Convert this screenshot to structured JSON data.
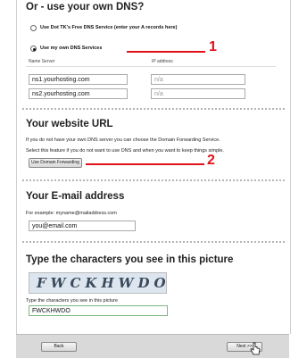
{
  "dns": {
    "title": "Or - use your own DNS?",
    "option_free": "Use Dot TK's Free DNS Service (enter your A records here)",
    "option_own": "Use my own DNS Services",
    "col_name_server": "Name Server",
    "col_ip": "IP address",
    "rows": [
      {
        "server": "ns1.yourhosting.com",
        "ip": "n/a"
      },
      {
        "server": "ns2.yourhosting.com",
        "ip": "n/a"
      }
    ]
  },
  "url": {
    "title": "Your website URL",
    "desc1": "If you do not have your own DNS server you can choose the Domain Forwarding Service.",
    "desc2": "Select this feature if you do not want to use DNS and when you want to keep things simple.",
    "button": "Use Domain Forwarding"
  },
  "email": {
    "title": "Your E-mail address",
    "example": "For example: myname@mailaddress.com",
    "value": "you@email.com"
  },
  "captcha": {
    "title": "Type the characters you see in this picture",
    "image_text": "FWCKHWDO",
    "label": "Type the characters you see in this picture",
    "value": "FWCKHWDO"
  },
  "annotations": {
    "mark1": "1",
    "mark2": "2",
    "color": "#e0111b"
  },
  "footer": {
    "back": "Back",
    "next": "Next >>"
  }
}
